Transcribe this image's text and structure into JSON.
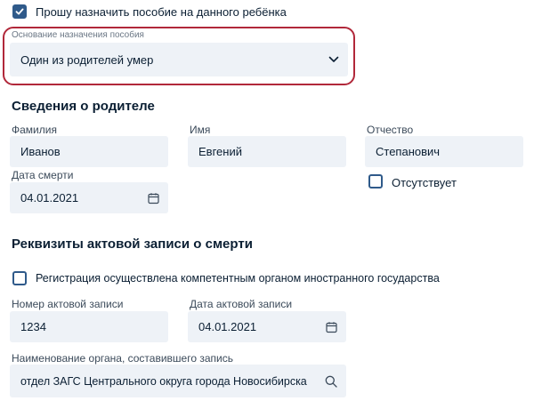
{
  "top_checkbox": {
    "label": "Прошу назначить пособие на данного ребёнка",
    "checked": true
  },
  "basis": {
    "label": "Основание назначения пособия",
    "value": "Один из родителей умер"
  },
  "parent_section": {
    "title": "Сведения о родителе",
    "surname": {
      "label": "Фамилия",
      "value": "Иванов"
    },
    "name": {
      "label": "Имя",
      "value": "Евгений"
    },
    "patronymic": {
      "label": "Отчество",
      "value": "Степанович"
    },
    "death_date": {
      "label": "Дата смерти",
      "value": "04.01.2021"
    },
    "absent_checkbox": {
      "label": "Отсутствует",
      "checked": false
    }
  },
  "record_section": {
    "title": "Реквизиты актовой записи о смерти",
    "foreign_checkbox": {
      "label": "Регистрация осуществлена компетентным органом иностранного государства",
      "checked": false
    },
    "record_number": {
      "label": "Номер актовой записи",
      "value": "1234"
    },
    "record_date": {
      "label": "Дата актовой записи",
      "value": "04.01.2021"
    },
    "organ": {
      "label": "Наименование органа, составившего запись",
      "value": "отдел ЗАГС Центрального округа города Новосибирска"
    }
  },
  "colors": {
    "accent": "#2f5a8a",
    "highlight": "#b1283a",
    "field_bg": "#eef2f7"
  },
  "icons": {
    "chevron": "chevron-down-icon",
    "calendar": "calendar-icon",
    "search": "search-icon",
    "check": "checkmark-icon"
  }
}
